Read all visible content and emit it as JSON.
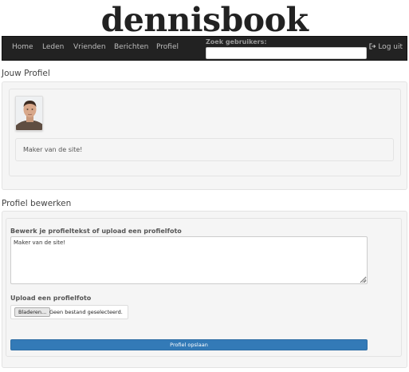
{
  "brand": {
    "title": "dennisbook"
  },
  "nav": {
    "items": [
      "Home",
      "Leden",
      "Vrienden",
      "Berichten",
      "Profiel"
    ],
    "search_label": "Zoek gebruikers:",
    "search_value": "",
    "logout_label": "Log uit",
    "logout_icon": "logout-icon"
  },
  "profile": {
    "section_title": "Jouw Profiel",
    "avatar": "profile-photo",
    "bio": "Maker van de site!"
  },
  "edit": {
    "section_title": "Profiel bewerken",
    "text_label": "Bewerk je profieltekst of upload een profielfoto",
    "text_value": "Maker van de site!",
    "upload_label": "Upload een profielfoto",
    "browse_button": "Bladeren...",
    "file_status": "Geen bestand geselecteerd.",
    "save_button": "Profiel opslaan"
  },
  "colors": {
    "navbar": "#222222",
    "primary": "#337ab7",
    "well": "#f5f5f5"
  }
}
